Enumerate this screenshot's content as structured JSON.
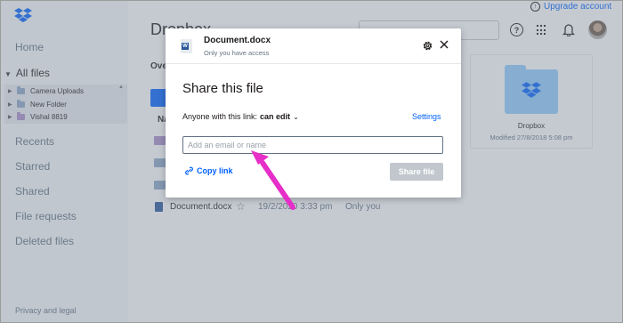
{
  "topbar": {
    "upgrade_label": "Upgrade account",
    "page_title": "Dropbox"
  },
  "sidebar": {
    "home": "Home",
    "all_files": "All files",
    "tree": [
      {
        "label": "Camera Uploads"
      },
      {
        "label": "New Folder"
      },
      {
        "label": "Vishal 8819"
      }
    ],
    "recents": "Recents",
    "starred": "Starred",
    "shared": "Shared",
    "file_requests": "File requests",
    "deleted_files": "Deleted files",
    "privacy": "Privacy and legal"
  },
  "main": {
    "overview": "Ove",
    "name_header": "Na",
    "file_row": {
      "name": "Document.docx",
      "modified": "19/2/2020 3:33 pm",
      "access": "Only you"
    },
    "tile": {
      "name": "Dropbox",
      "meta": "Modified 27/8/2018 5:08 pm"
    }
  },
  "modal": {
    "file_name": "Document.docx",
    "access": "Only you have access",
    "title": "Share this file",
    "permission_label": "Anyone with this link:",
    "permission_value": "can edit",
    "settings": "Settings",
    "email_placeholder": "Add an email or name",
    "copy_link": "Copy link",
    "share_button": "Share file"
  },
  "colors": {
    "accent": "#0061fe",
    "annotation_arrow": "#e62ec8"
  },
  "icons": [
    "dropbox-logo-icon",
    "upgrade-icon",
    "help-icon",
    "apps-grid-icon",
    "bell-icon",
    "word-doc-icon",
    "gear-icon",
    "close-icon",
    "link-icon",
    "star-icon",
    "folder-icon"
  ]
}
